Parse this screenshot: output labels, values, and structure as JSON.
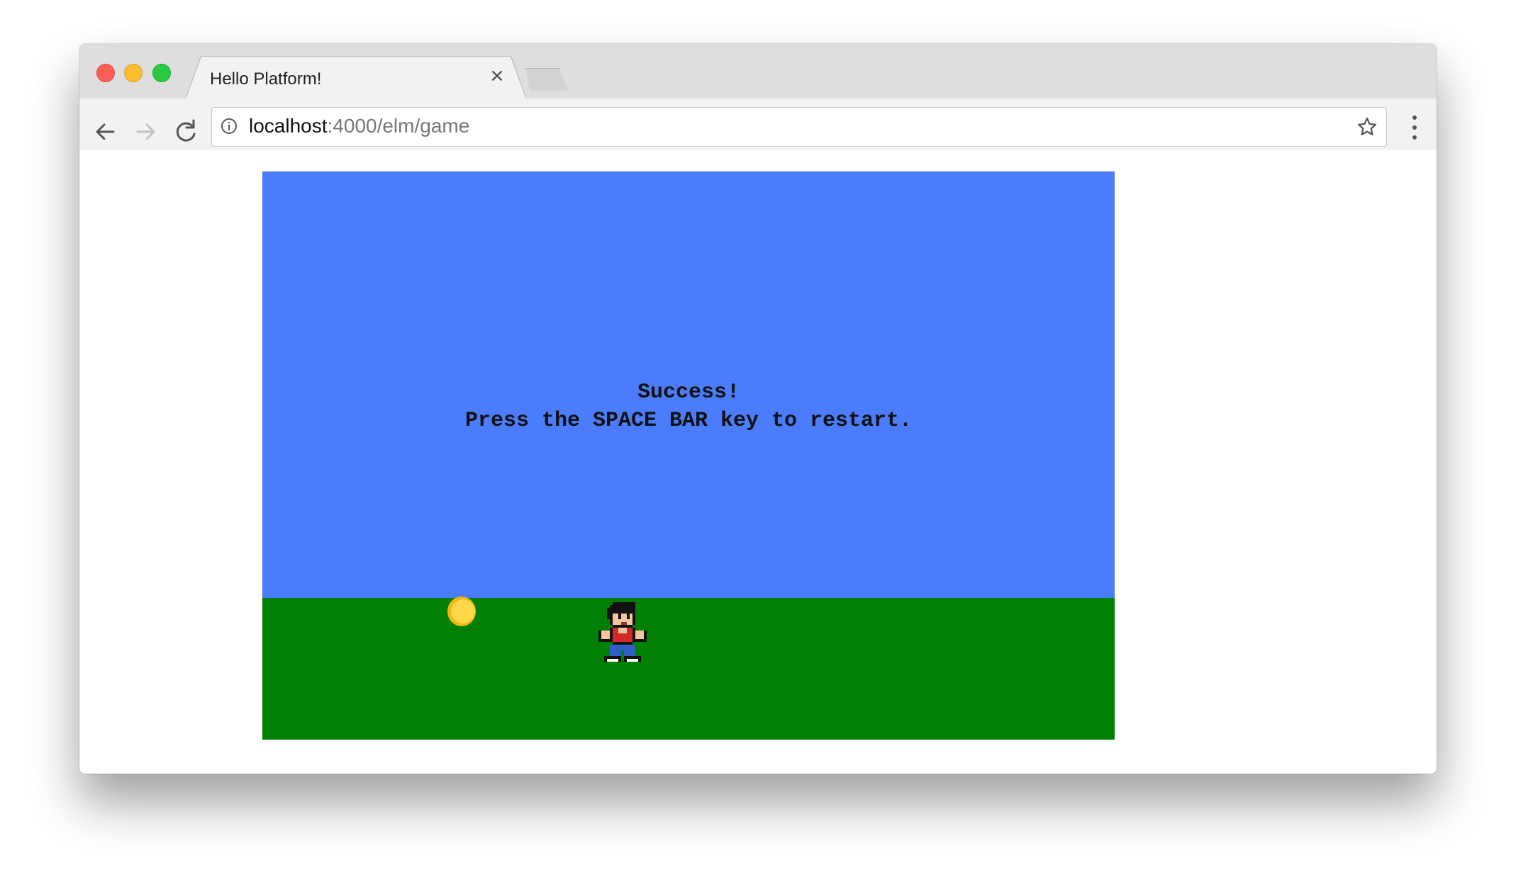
{
  "browser": {
    "tab_title": "Hello Platform!",
    "tab_close_glyph": "×",
    "url_host": "localhost",
    "url_path": ":4000/elm/game",
    "icons": {
      "back": "arrow-left-icon",
      "forward": "arrow-right-icon",
      "reload": "reload-icon",
      "info": "info-icon",
      "bookmark": "star-icon",
      "menu": "kebab-menu-icon"
    }
  },
  "game": {
    "message_line1": "Success!",
    "message_line2": "Press the SPACE BAR key to restart.",
    "colors": {
      "sky": "#4a7cfc",
      "ground": "#028003",
      "coin": "#ffd84a"
    }
  }
}
